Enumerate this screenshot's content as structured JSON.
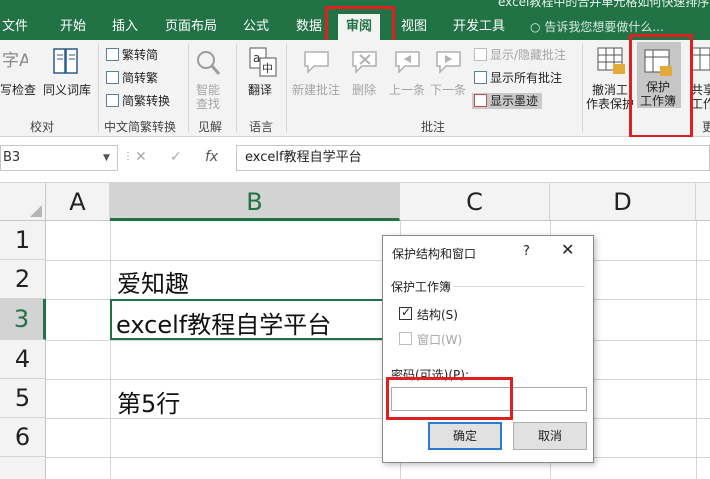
{
  "window": {
    "title_fragment": "excel教程中的合并单元格如何快速排序..."
  },
  "tabs": [
    {
      "label": "文件"
    },
    {
      "label": "开始"
    },
    {
      "label": "插入"
    },
    {
      "label": "页面布局"
    },
    {
      "label": "公式"
    },
    {
      "label": "数据"
    },
    {
      "label": "审阅"
    },
    {
      "label": "视图"
    },
    {
      "label": "开发工具"
    }
  ],
  "tell_me": "告诉我您想要做什么...",
  "ribbon": {
    "proofing": {
      "spell_check": "写检查",
      "thesaurus": "同义词库",
      "group": "校对"
    },
    "chinese_conversion": {
      "to_simplified": "繁转简",
      "to_traditional": "简转繁",
      "convert": "简繁转换",
      "group": "中文简繁转换"
    },
    "insights": {
      "smart_lookup_1": "智能",
      "smart_lookup_2": "查找",
      "group": "见解"
    },
    "language": {
      "translate": "翻译",
      "group": "语言"
    },
    "comments": {
      "new": "新建批注",
      "delete": "删除",
      "prev": "上一条",
      "next": "下一条",
      "show_hide": "显示/隐藏批注",
      "show_all": "显示所有批注",
      "show_ink": "显示墨迹",
      "group": "批注"
    },
    "changes": {
      "unprotect_sheet_1": "撤消工",
      "unprotect_sheet_2": "作表保护",
      "protect_workbook_1": "保护",
      "protect_workbook_2": "工作簿",
      "share_1": "共享",
      "share_2": "工作",
      "group_fragment": "更"
    }
  },
  "formula_bar": {
    "name_box": "B3",
    "content": "excelf教程自学平台",
    "fx": "fx"
  },
  "sheet": {
    "columns": [
      "A",
      "B",
      "C",
      "D"
    ],
    "rows": [
      "1",
      "2",
      "3",
      "4",
      "5",
      "6"
    ],
    "cells": {
      "B2": "爱知趣",
      "B3": "excelf教程自学平台",
      "B5": "第5行"
    }
  },
  "dialog": {
    "title": "保护结构和窗口",
    "help": "?",
    "close": "✕",
    "group_label": "保护工作簿",
    "structure": {
      "label": "结构(S)",
      "checked": true
    },
    "windows": {
      "label": "窗口(W)",
      "checked": false
    },
    "password_label": "密码(可选)(P):",
    "password_value": "",
    "ok": "确定",
    "cancel": "取消"
  },
  "colors": {
    "excel_green": "#217346",
    "highlight_red": "#e02020"
  }
}
